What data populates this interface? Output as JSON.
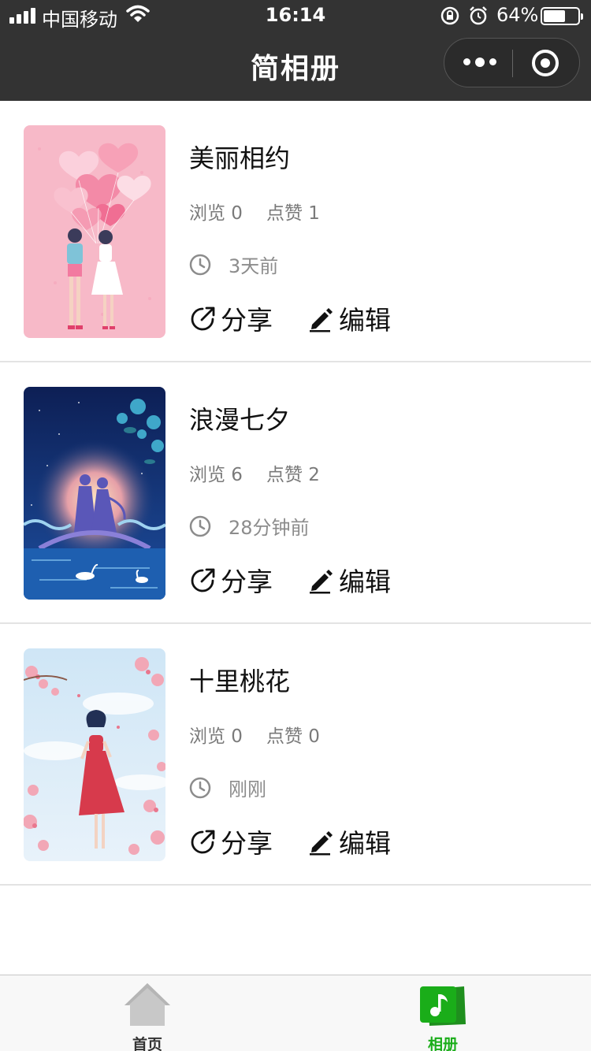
{
  "status_bar": {
    "carrier": "中国移动",
    "time": "16:14",
    "battery": "64%",
    "battery_level": 0.64
  },
  "nav": {
    "title": "简相册"
  },
  "albums": [
    {
      "name": "美丽相约",
      "views": "浏览 0",
      "likes": "点赞 1",
      "time": "3天前",
      "share_label": "分享",
      "edit_label": "编辑",
      "cover": "couple-heart-balloons"
    },
    {
      "name": "浪漫七夕",
      "views": "浏览 6",
      "likes": "点赞 2",
      "time": "28分钟前",
      "share_label": "分享",
      "edit_label": "编辑",
      "cover": "qixi-couple-bridge-night"
    },
    {
      "name": "十里桃花",
      "views": "浏览 0",
      "likes": "点赞 0",
      "time": "刚刚",
      "share_label": "分享",
      "edit_label": "编辑",
      "cover": "girl-peach-blossoms"
    }
  ],
  "tabbar": {
    "tabs": [
      {
        "label": "首页",
        "icon": "home-icon",
        "active": false
      },
      {
        "label": "相册",
        "icon": "music-album-icon",
        "active": true
      }
    ],
    "active_color": "#1aad19"
  },
  "colors": {
    "header_bg": "#333333",
    "accent": "#1aad19"
  }
}
